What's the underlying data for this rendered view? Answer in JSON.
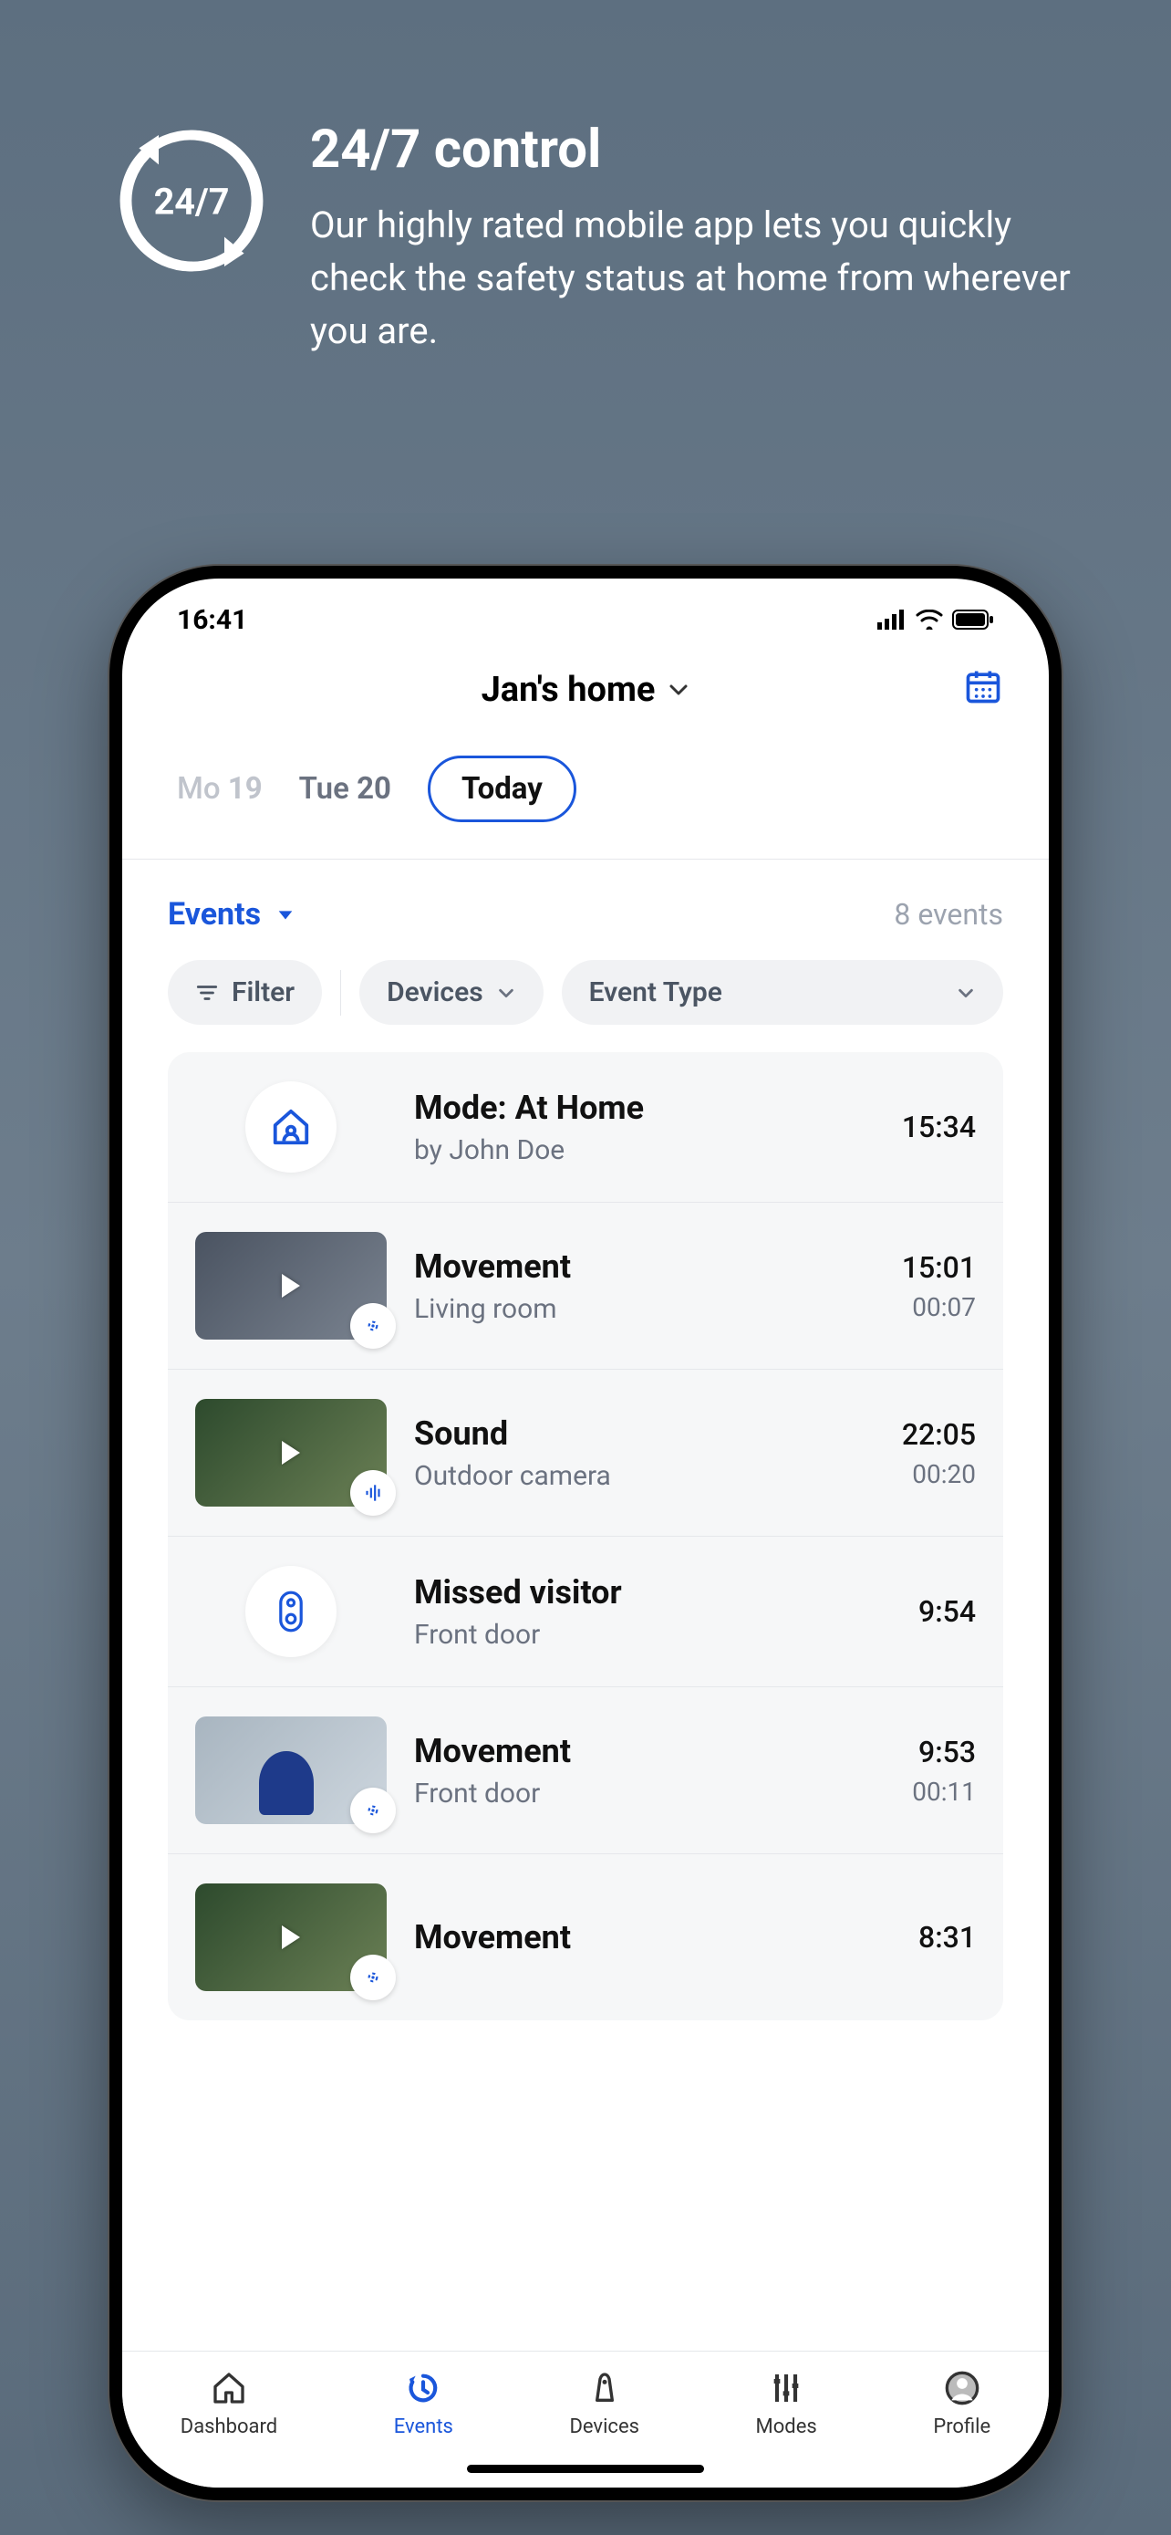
{
  "promo": {
    "title": "24/7 control",
    "subtitle": "Our highly rated mobile app lets you quickly check the safety status at home from wherever you are.",
    "icon_label": "24/7"
  },
  "statusbar": {
    "time": "16:41"
  },
  "header": {
    "home_name": "Jan's home"
  },
  "day_tabs": [
    {
      "label": "Mo",
      "num": "19"
    },
    {
      "label": "Tue",
      "num": "20"
    },
    {
      "label": "Today",
      "num": ""
    }
  ],
  "section": {
    "dropdown_label": "Events",
    "count_label": "8 events"
  },
  "filters": {
    "filter": "Filter",
    "devices": "Devices",
    "event_type": "Event Type"
  },
  "events": [
    {
      "title": "Mode: At Home",
      "sub": "by John Doe",
      "time": "15:34",
      "dur": ""
    },
    {
      "title": "Movement",
      "sub": "Living room",
      "time": "15:01",
      "dur": "00:07"
    },
    {
      "title": "Sound",
      "sub": "Outdoor camera",
      "time": "22:05",
      "dur": "00:20"
    },
    {
      "title": "Missed visitor",
      "sub": "Front door",
      "time": "9:54",
      "dur": ""
    },
    {
      "title": "Movement",
      "sub": "Front door",
      "time": "9:53",
      "dur": "00:11"
    },
    {
      "title": "Movement",
      "sub": "",
      "time": "8:31",
      "dur": ""
    }
  ],
  "tabbar": {
    "dashboard": "Dashboard",
    "events": "Events",
    "devices": "Devices",
    "modes": "Modes",
    "profile": "Profile"
  }
}
